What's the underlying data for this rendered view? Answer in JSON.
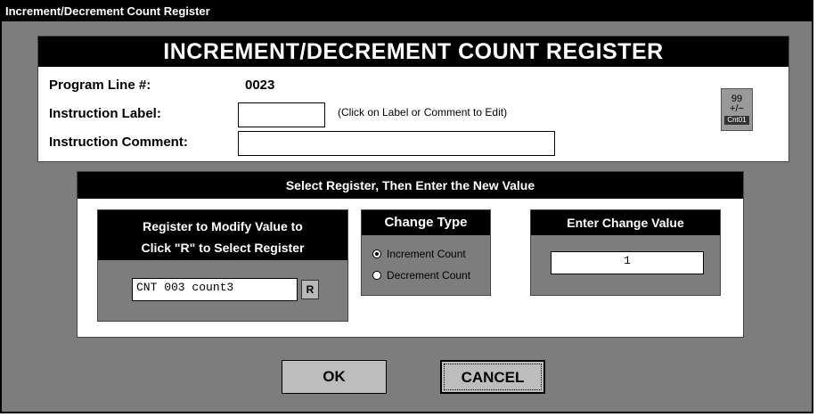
{
  "window": {
    "title": "Increment/Decrement Count Register"
  },
  "header": {
    "title": "INCREMENT/DECREMENT COUNT REGISTER"
  },
  "program_line": {
    "label": "Program Line #:",
    "value": "0023"
  },
  "instruction_label": {
    "label": "Instruction Label:",
    "value": "",
    "hint": "(Click on Label or Comment to Edit)"
  },
  "instruction_comment": {
    "label": "Instruction Comment:",
    "value": ""
  },
  "counter_icon": {
    "top": "99",
    "middle": "+/−",
    "bottom": "Cnt01",
    "icon": "counter-icon"
  },
  "select_panel": {
    "title": "Select Register, Then Enter the New Value"
  },
  "register": {
    "title_line1": "Register to Modify Value to",
    "title_line2": "Click \"R\" to Select Register",
    "value": "CNT 003  count3",
    "button_label": "R"
  },
  "change_type": {
    "title": "Change Type",
    "options": [
      {
        "label": "Increment Count",
        "selected": true
      },
      {
        "label": "Decrement Count",
        "selected": false
      }
    ]
  },
  "change_value": {
    "title": "Enter Change Value",
    "value": "1"
  },
  "buttons": {
    "ok": "OK",
    "cancel": "CANCEL"
  }
}
